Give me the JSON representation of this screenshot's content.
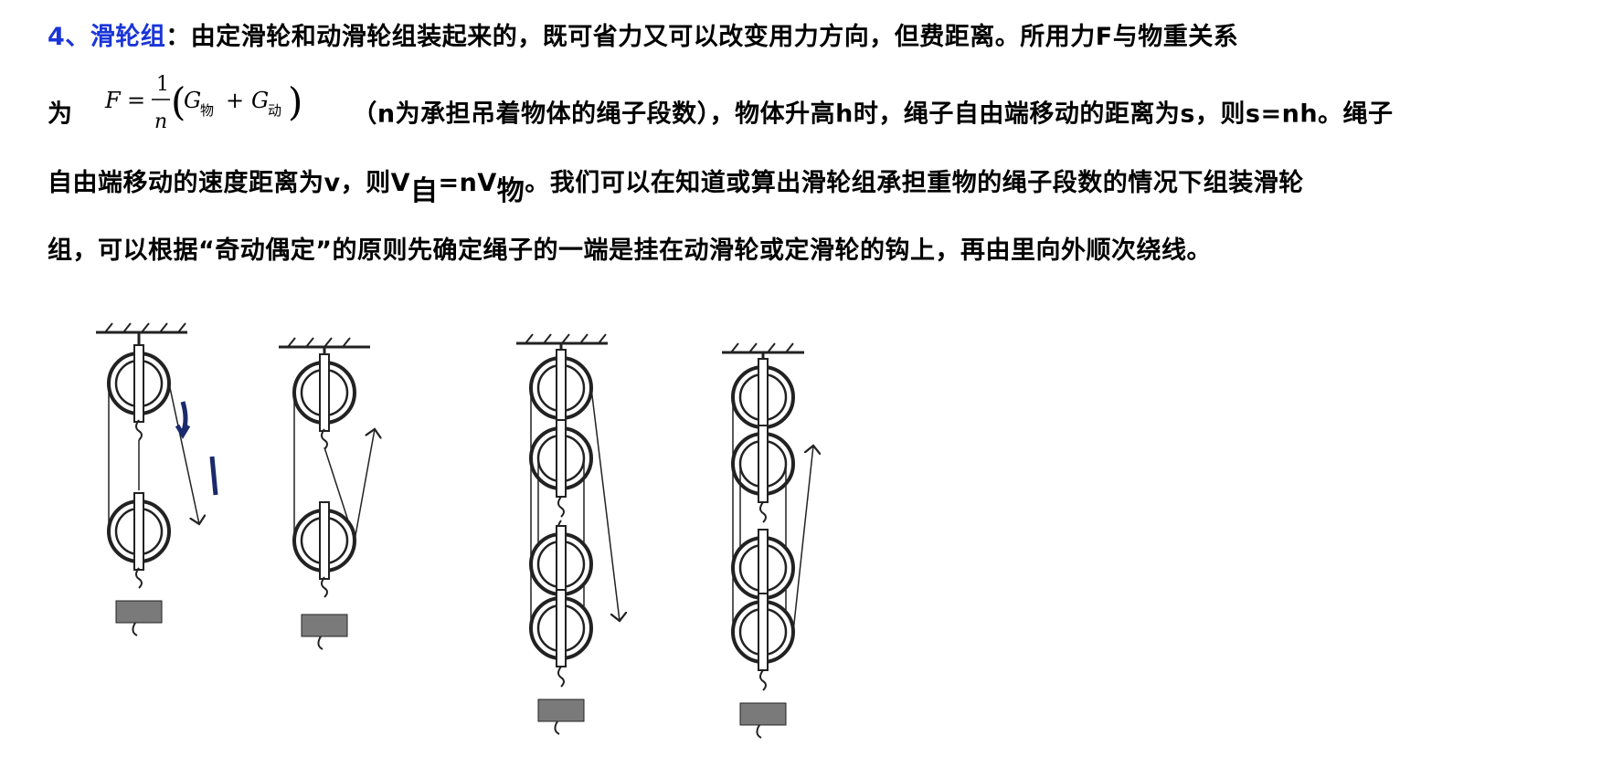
{
  "section": {
    "heading": "4、滑轮组",
    "line1_text": "：由定滑轮和动滑轮组装起来的，既可省力又可以改变用力方向，但费距离。所用力F与物重关系",
    "line2_prefix": "为",
    "formula": {
      "lhs": "F",
      "eq": "=",
      "numerator": "1",
      "denominator": "n",
      "g1": "G",
      "g1_sub": "物",
      "plus": "+",
      "g2": "G",
      "g2_sub": "动"
    },
    "line2_text": "（n为承担吊着物体的绳子段数），物体升高h时，绳子自由端移动的距离为s，则s=nh。绳子",
    "line3_text_a": "自由端移动的速度距离为v，则V",
    "line3_sub_a": "自",
    "line3_text_b": "=nV",
    "line3_sub_b": "物",
    "line3_text_c": "。我们可以在知道或算出滑轮组承担重物的绳子段数的情况下组装滑轮",
    "line4_text": "组，可以根据“奇动偶定”的原则先确定绳子的一端是挂在动滑轮或定滑轮的钩上，再由里向外顺次绕线。"
  },
  "diagram": {
    "description_icon": "pulley-systems-diagram",
    "handwritten_mark": "↓|",
    "ink_color": "#1a2a6c",
    "line_color": "#222222",
    "weight_color": "#7a7a7a"
  }
}
